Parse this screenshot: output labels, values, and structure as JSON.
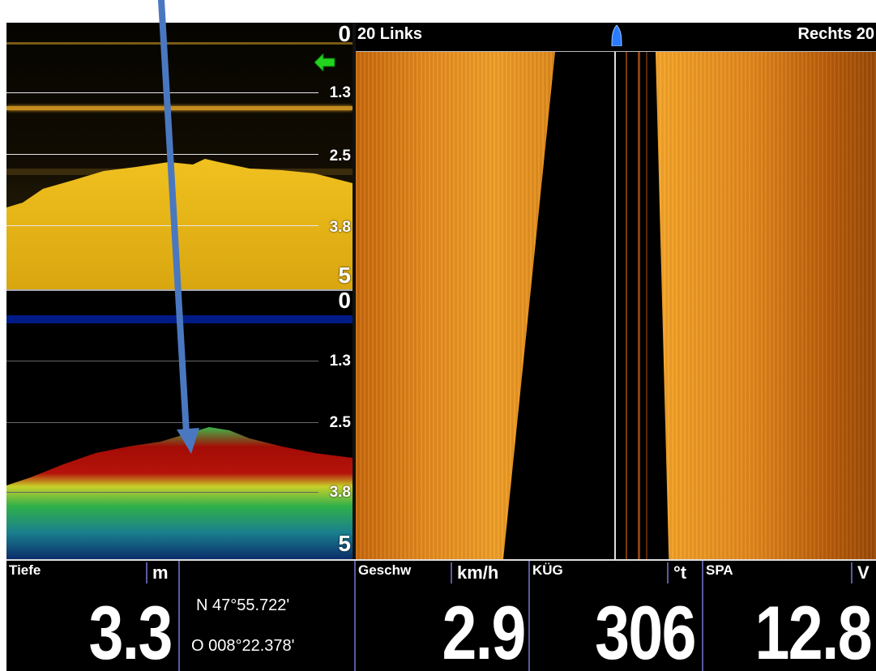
{
  "side_imaging": {
    "left_label": "20 Links",
    "right_label": "Rechts 20"
  },
  "down_imaging": {
    "depth_scale": [
      "0",
      "1.3",
      "2.5",
      "3.8",
      "5"
    ]
  },
  "sonar": {
    "depth_scale": [
      "0",
      "1.3",
      "2.5",
      "3.8",
      "5"
    ]
  },
  "databar": {
    "depth": {
      "label": "Tiefe",
      "unit": "m",
      "value": "3.3"
    },
    "gps": {
      "lat": "N 47°55.722'",
      "lon": "O 008°22.378'"
    },
    "speed": {
      "label": "Geschw",
      "unit": "km/h",
      "value": "2.9"
    },
    "heading": {
      "label": "KÜG",
      "unit": "°t",
      "value": "306"
    },
    "voltage": {
      "label": "SPA",
      "unit": "V",
      "value": "12.8"
    }
  },
  "colors": {
    "annotation_arrow": "#4a78c0",
    "cursor_arrow": "#22d41e",
    "boat_icon": "#2a7bff"
  }
}
